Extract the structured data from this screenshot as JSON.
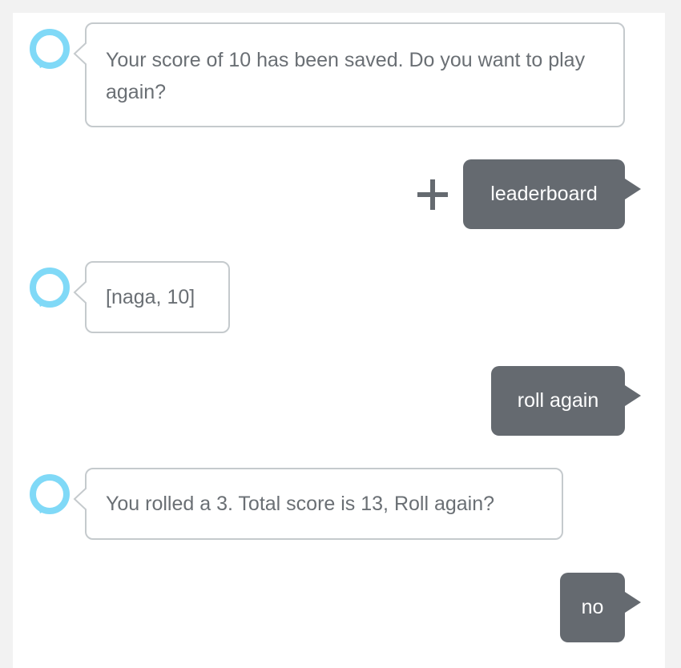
{
  "conversation": {
    "messages": [
      {
        "speaker": "alexa",
        "text": "Your score of 10 has been saved. Do you want to play again?"
      },
      {
        "speaker": "user",
        "text": "leaderboard"
      },
      {
        "speaker": "alexa",
        "text": "[naga, 10]"
      },
      {
        "speaker": "user",
        "text": "roll again"
      },
      {
        "speaker": "alexa",
        "text": "You rolled a 3. Total score is 13, Roll again?"
      },
      {
        "speaker": "user",
        "text": "no"
      }
    ]
  },
  "icons": {
    "avatar": "alexa-ring-icon",
    "add": "plus-icon"
  },
  "colors": {
    "alexa_ring": "#80d9f7",
    "alexa_bubble_border": "#c5cacd",
    "alexa_text": "#6a6f74",
    "user_bubble": "#656a70",
    "user_text": "#ffffff",
    "background": "#f2f2f2"
  }
}
